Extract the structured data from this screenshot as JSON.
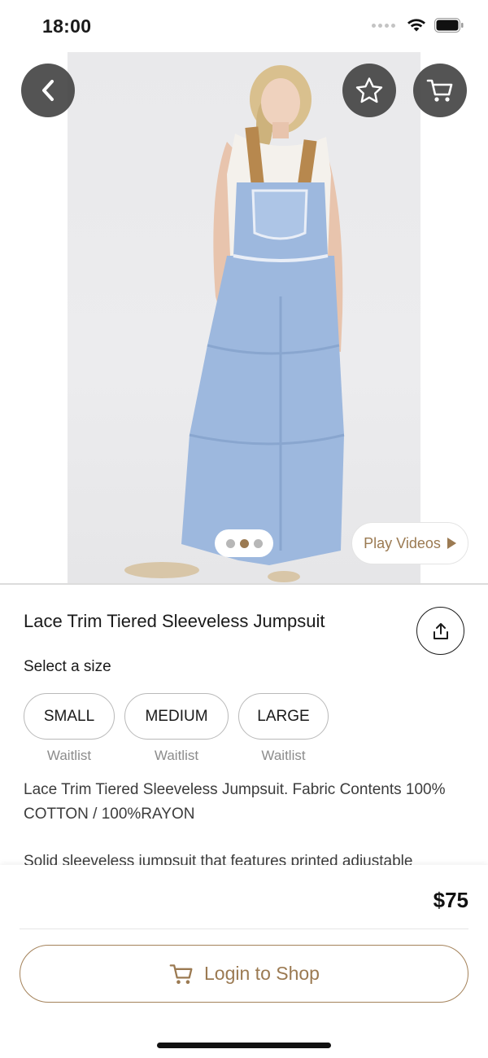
{
  "status_bar": {
    "time": "18:00",
    "icons": [
      "cellular-dots-icon",
      "wifi-icon",
      "battery-icon"
    ]
  },
  "hero": {
    "image_alt": "Model wearing light blue tiered sleeveless jumpsuit",
    "buttons": {
      "back": "chevron-left-icon",
      "favorite": "star-icon",
      "cart": "cart-icon"
    },
    "carousel": {
      "count": 3,
      "active_index": 1
    },
    "play_videos_label": "Play Videos"
  },
  "product": {
    "title": "Lace Trim Tiered Sleeveless Jumpsuit",
    "size_label": "Select a size",
    "sizes": [
      {
        "label": "SMALL",
        "status": "Waitlist"
      },
      {
        "label": "MEDIUM",
        "status": "Waitlist"
      },
      {
        "label": "LARGE",
        "status": "Waitlist"
      }
    ],
    "description": "Lace Trim Tiered Sleeveless Jumpsuit. Fabric Contents 100% COTTON / 100%RAYON",
    "description_more": "Solid sleeveless jumpsuit that features printed adjustable"
  },
  "checkout": {
    "price": "$75",
    "login_label": "Login to Shop"
  },
  "colors": {
    "accent": "#9b7a52",
    "button_dark": "#3c3c3c",
    "garment": "#9db8de"
  }
}
